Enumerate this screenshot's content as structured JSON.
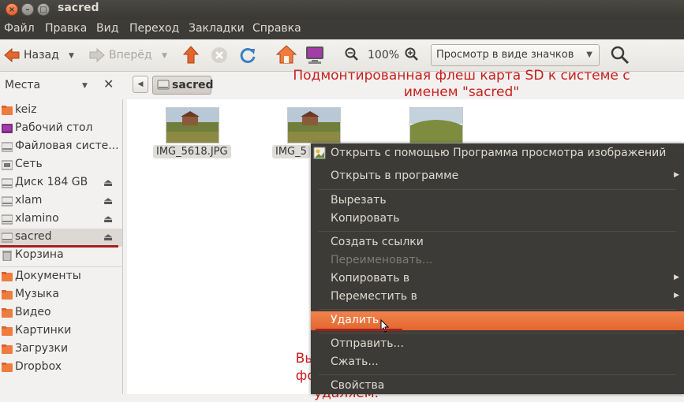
{
  "window": {
    "title": "sacred",
    "close_glyph": "×",
    "min_glyph": "–",
    "max_glyph": "□"
  },
  "menubar": [
    "Файл",
    "Правка",
    "Вид",
    "Переход",
    "Закладки",
    "Справка"
  ],
  "toolbar": {
    "back_label": "Назад",
    "forward_label": "Вперёд",
    "zoom_level": "100%",
    "view_mode": "Просмотр в виде значков"
  },
  "sidebar": {
    "title": "Места",
    "items": [
      {
        "label": "keiz"
      },
      {
        "label": "Рабочий стол"
      },
      {
        "label": "Файловая систе..."
      },
      {
        "label": "Сеть"
      },
      {
        "label": "Диск 184 GB"
      },
      {
        "label": "xlam"
      },
      {
        "label": "xlamino"
      },
      {
        "label": "sacred"
      },
      {
        "label": "Корзина"
      },
      {
        "label": "Документы"
      },
      {
        "label": "Музыка"
      },
      {
        "label": "Видео"
      },
      {
        "label": "Картинки"
      },
      {
        "label": "Загрузки"
      },
      {
        "label": "Dropbox"
      }
    ]
  },
  "location": {
    "crumb": "sacred"
  },
  "files": [
    {
      "name": "IMG_5618.JPG"
    },
    {
      "name": "IMG_5"
    },
    {
      "name": ""
    }
  ],
  "annotations": {
    "top_line1": "Подмонтированная флеш карта SD к системе с",
    "top_line2": "именем \"sacred\"",
    "middle_line1": "Выделяем три",
    "middle_line2": "фотографии и",
    "middle_line3": "удаляем."
  },
  "context_menu": [
    {
      "label": "Открыть с помощью Программа просмотра изображений"
    },
    {
      "label": "Открыть в программе"
    },
    {
      "label": "Вырезать"
    },
    {
      "label": "Копировать"
    },
    {
      "label": "Создать ссылки"
    },
    {
      "label": "Переименовать..."
    },
    {
      "label": "Копировать в"
    },
    {
      "label": "Переместить в"
    },
    {
      "label": "Удалить"
    },
    {
      "label": "Отправить..."
    },
    {
      "label": "Сжать..."
    },
    {
      "label": "Свойства"
    }
  ],
  "colors": {
    "accent": "#e3662c",
    "annotation": "#c8201c",
    "menubar": "#3c3b37"
  }
}
